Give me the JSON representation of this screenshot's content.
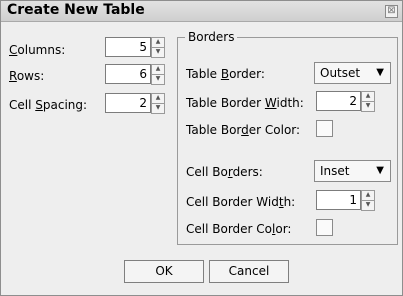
{
  "dialog": {
    "title": "Create New Table",
    "close_glyph": "⊠"
  },
  "left": {
    "columns": {
      "label": "Columns:",
      "value": "5"
    },
    "rows": {
      "label": "Rows:",
      "value": "6"
    },
    "cell_spacing": {
      "label": "Cell Spacing:",
      "value": "2"
    }
  },
  "borders": {
    "group_label": "Borders",
    "table_border": {
      "label": "Table Border:",
      "value": "Outset"
    },
    "table_border_width": {
      "label": "Table Border Width:",
      "value": "2"
    },
    "table_border_color": {
      "label": "Table Border Color:"
    },
    "cell_borders": {
      "label": "Cell Borders:",
      "value": "Inset"
    },
    "cell_border_width": {
      "label": "Cell Border Width:",
      "value": "1"
    },
    "cell_border_color": {
      "label": "Cell Border Color:"
    }
  },
  "buttons": {
    "ok": "OK",
    "cancel": "Cancel"
  },
  "icons": {
    "spin_up": "▲",
    "spin_down": "▼",
    "dropdown": "▼"
  }
}
